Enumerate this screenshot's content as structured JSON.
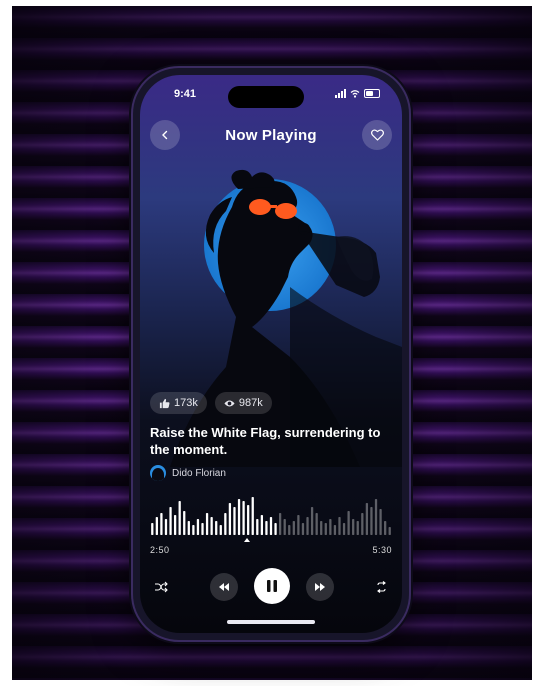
{
  "status": {
    "time": "9:41"
  },
  "header": {
    "title": "Now Playing"
  },
  "stats": {
    "likes": "173k",
    "views": "987k"
  },
  "song": {
    "title": "Raise the White Flag, surrendering to the moment.",
    "artist": "Dido Florian"
  },
  "progress": {
    "current": "2:50",
    "total": "5:30",
    "fraction": 0.515,
    "waveform": [
      0.3,
      0.45,
      0.55,
      0.4,
      0.7,
      0.5,
      0.85,
      0.6,
      0.35,
      0.25,
      0.4,
      0.3,
      0.55,
      0.45,
      0.35,
      0.25,
      0.55,
      0.8,
      0.7,
      0.9,
      0.85,
      0.75,
      0.95,
      0.4,
      0.5,
      0.35,
      0.45,
      0.3,
      0.55,
      0.4,
      0.25,
      0.35,
      0.5,
      0.3,
      0.45,
      0.7,
      0.55,
      0.35,
      0.3,
      0.4,
      0.25,
      0.45,
      0.3,
      0.6,
      0.4,
      0.35,
      0.55,
      0.8,
      0.7,
      0.9,
      0.65,
      0.35,
      0.2
    ]
  },
  "colors": {
    "accent": "#2a8de0",
    "glasses": "#ff5a1f"
  },
  "icons": {
    "back": "chevron-left-icon",
    "favorite": "heart-icon",
    "likes": "thumbs-up-icon",
    "views": "eye-icon",
    "shuffle": "shuffle-icon",
    "prev": "rewind-icon",
    "play": "pause-icon",
    "next": "fast-forward-icon",
    "repeat": "repeat-icon"
  }
}
